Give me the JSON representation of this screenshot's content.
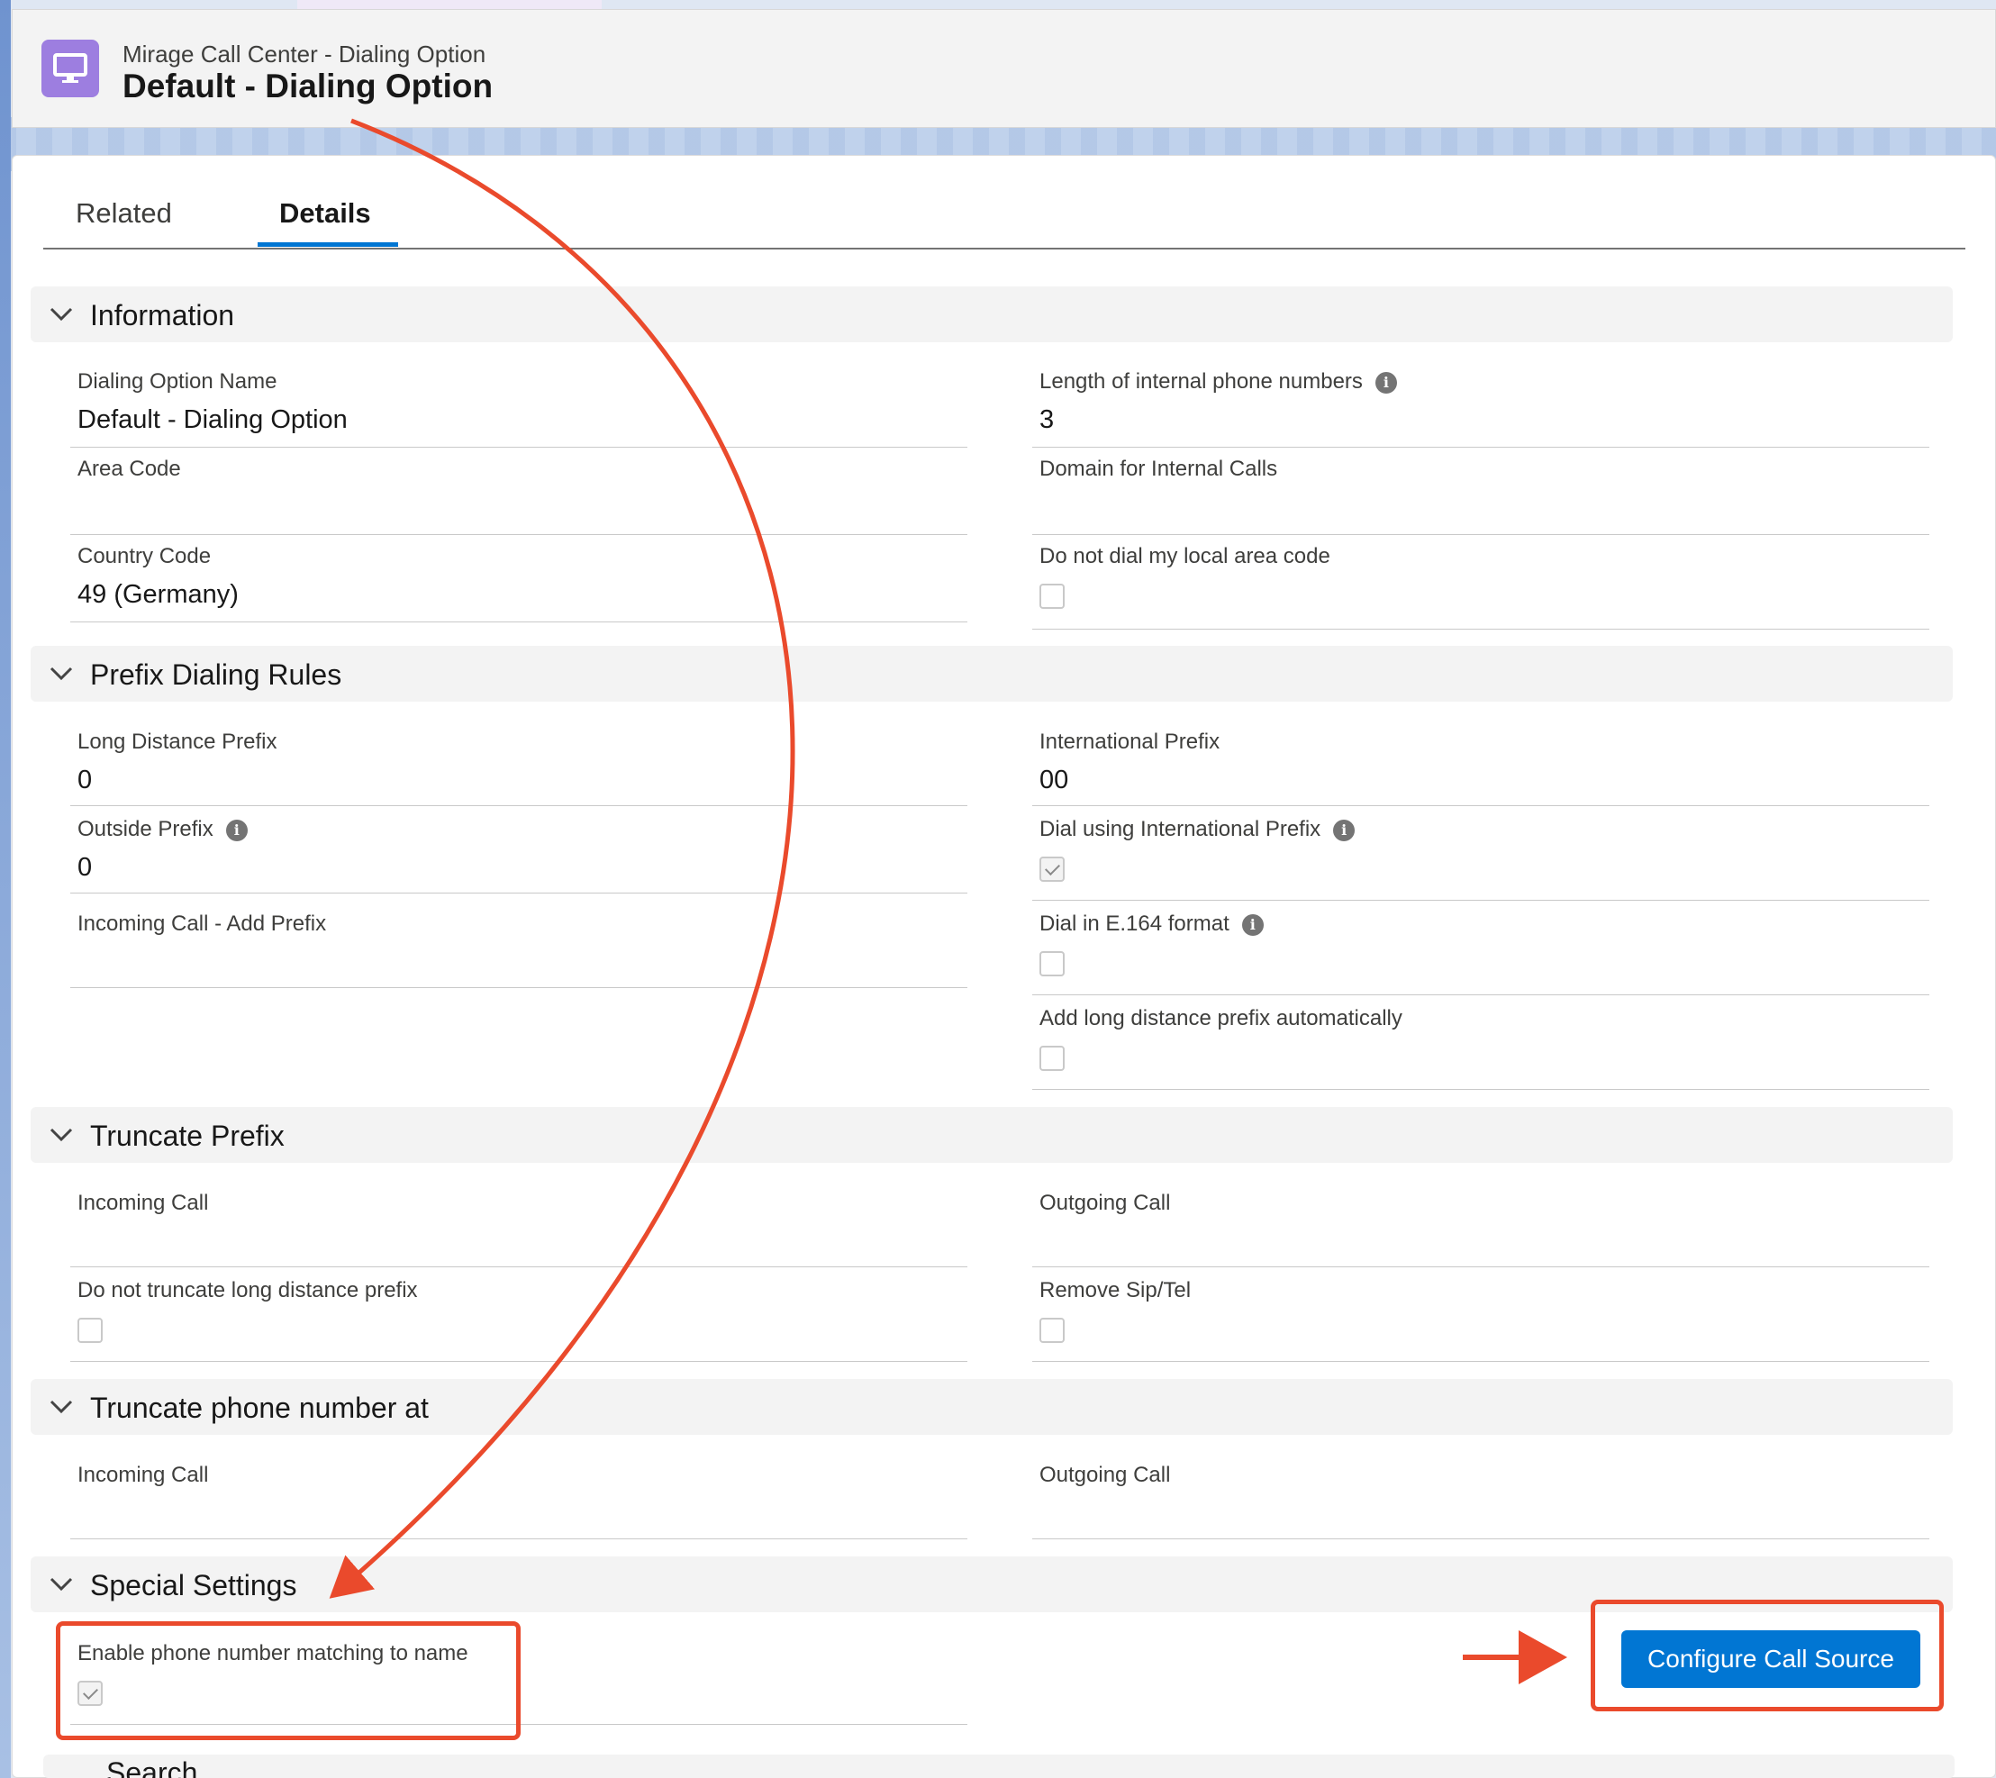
{
  "header": {
    "breadcrumb": "Mirage Call Center - Dialing Option",
    "title": "Default - Dialing Option",
    "icon": "monitor-icon"
  },
  "tabs": [
    {
      "label": "Related"
    },
    {
      "label": "Details",
      "active": true
    }
  ],
  "sections": {
    "information": {
      "title": "Information",
      "dialing_option_name": {
        "label": "Dialing Option Name",
        "value": "Default - Dialing Option"
      },
      "length_internal": {
        "label": "Length of internal phone numbers",
        "value": "3"
      },
      "area_code": {
        "label": "Area Code",
        "value": ""
      },
      "domain_internal": {
        "label": "Domain for Internal Calls",
        "value": ""
      },
      "country_code": {
        "label": "Country Code",
        "value": "49 (Germany)"
      },
      "do_not_dial_local": {
        "label": "Do not dial my local area code",
        "checked": false
      }
    },
    "prefix": {
      "title": "Prefix Dialing Rules",
      "long_distance_prefix": {
        "label": "Long Distance Prefix",
        "value": "0"
      },
      "international_prefix": {
        "label": "International Prefix",
        "value": "00"
      },
      "outside_prefix": {
        "label": "Outside Prefix",
        "value": "0"
      },
      "dial_using_international": {
        "label": "Dial using International Prefix",
        "checked": true
      },
      "incoming_add_prefix": {
        "label": "Incoming Call - Add Prefix",
        "value": ""
      },
      "dial_e164": {
        "label": "Dial in E.164 format",
        "checked": false
      },
      "add_long_distance_auto": {
        "label": "Add long distance prefix automatically",
        "checked": false
      }
    },
    "truncate_prefix": {
      "title": "Truncate Prefix",
      "incoming_call": {
        "label": "Incoming Call",
        "value": ""
      },
      "outgoing_call": {
        "label": "Outgoing Call",
        "value": ""
      },
      "do_not_truncate": {
        "label": "Do not truncate long distance prefix",
        "checked": false
      },
      "remove_sip_tel": {
        "label": "Remove Sip/Tel",
        "checked": false
      }
    },
    "truncate_phone": {
      "title": "Truncate phone number at",
      "incoming_call": {
        "label": "Incoming Call",
        "value": ""
      },
      "outgoing_call": {
        "label": "Outgoing Call",
        "value": ""
      }
    },
    "special": {
      "title": "Special Settings",
      "enable_matching": {
        "label": "Enable phone number matching to name",
        "checked": true
      },
      "configure_button": "Configure Call Source"
    },
    "next_section_partial": "Search"
  },
  "colors": {
    "accent": "#0176d3",
    "annotation": "#ea4a2c",
    "icon_bg": "#9d7ee0"
  }
}
